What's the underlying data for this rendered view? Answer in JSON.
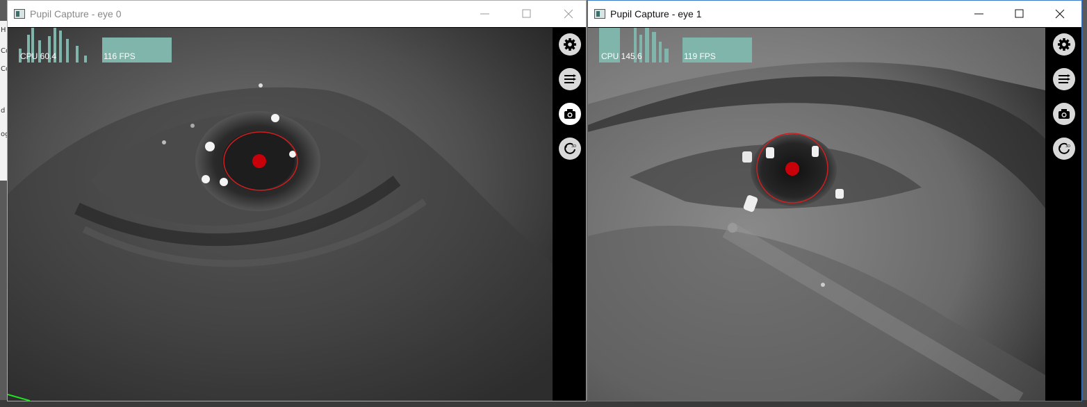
{
  "background": {
    "side_text": [
      "H",
      "Co",
      "Co",
      "d",
      "og"
    ]
  },
  "windows": [
    {
      "title": "Pupil Capture - eye 0",
      "cpu_label": "CPU 60.4",
      "fps_label": "116 FPS",
      "icons": {
        "app": "app-window-icon",
        "minimize": "minimize-icon",
        "maximize": "maximize-icon",
        "close": "close-icon",
        "settings": "gear-icon",
        "menu": "list-icon",
        "capture": "camera-icon",
        "model": "3d-model-reset-icon"
      },
      "colors": {
        "pupil_center": "#c8000a",
        "pupil_ellipse": "#d21e1e",
        "gaze_curve": "#1ee61e",
        "graph_fill": "#7fb5aa"
      }
    },
    {
      "title": "Pupil Capture - eye 1",
      "cpu_label": "CPU 145.6",
      "fps_label": "119 FPS",
      "icons": {
        "app": "app-window-icon",
        "minimize": "minimize-icon",
        "maximize": "maximize-icon",
        "close": "close-icon",
        "settings": "gear-icon",
        "menu": "list-icon",
        "capture": "camera-icon",
        "model": "3d-model-reset-icon"
      },
      "colors": {
        "pupil_center": "#c8000a",
        "pupil_ellipse": "#d21e1e",
        "graph_fill": "#7fb5aa"
      }
    }
  ]
}
